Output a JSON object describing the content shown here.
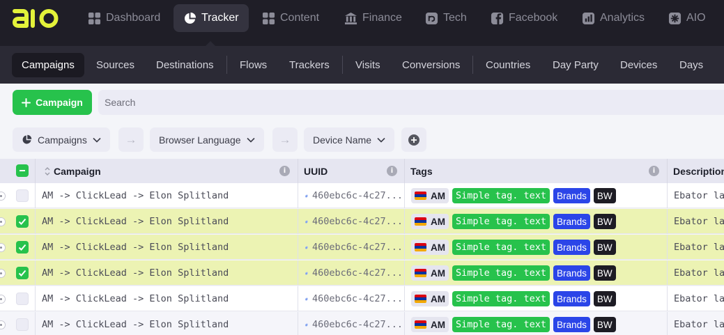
{
  "app": {
    "logo_text": "AIO"
  },
  "top_nav": [
    {
      "label": "Dashboard",
      "icon": "grid-icon"
    },
    {
      "label": "Tracker",
      "icon": "pie-chart-icon",
      "active": true
    },
    {
      "label": "Content",
      "icon": "grid-icon"
    },
    {
      "label": "Finance",
      "icon": "bank-icon"
    },
    {
      "label": "Tech",
      "icon": "tech-icon"
    },
    {
      "label": "Facebook",
      "icon": "facebook-icon"
    },
    {
      "label": "Analytics",
      "icon": "analytics-icon"
    },
    {
      "label": "AIO",
      "icon": "aio-icon"
    }
  ],
  "sub_nav": [
    {
      "label": "Campaigns",
      "active": true
    },
    {
      "label": "Sources"
    },
    {
      "label": "Destinations"
    },
    {
      "label": "Flows"
    },
    {
      "label": "Trackers"
    },
    {
      "label": "Visits"
    },
    {
      "label": "Conversions"
    },
    {
      "label": "Countries"
    },
    {
      "label": "Day Party"
    },
    {
      "label": "Devices"
    },
    {
      "label": "Days"
    }
  ],
  "actions": {
    "add_label": "Campaign",
    "search_placeholder": "Search"
  },
  "grouping": {
    "levels": [
      "Campaigns",
      "Browser Language",
      "Device Name"
    ],
    "arrow": "→"
  },
  "table": {
    "columns": [
      "Campaign",
      "UUID",
      "Tags",
      "Description"
    ],
    "info_glyph": "i",
    "rows": [
      {
        "selected": false,
        "campaign": "AM -> ClickLead -> Elon Splitland",
        "uuid": "460ebc6c-4c27...",
        "country": "AM",
        "tags": [
          "Simple tag. text",
          "Brands",
          "BW"
        ],
        "description": "Ebator lan"
      },
      {
        "selected": true,
        "campaign": "AM -> ClickLead -> Elon Splitland",
        "uuid": "460ebc6c-4c27...",
        "country": "AM",
        "tags": [
          "Simple tag. text",
          "Brands",
          "BW"
        ],
        "description": "Ebator lan"
      },
      {
        "selected": true,
        "campaign": "AM -> ClickLead -> Elon Splitland",
        "uuid": "460ebc6c-4c27...",
        "country": "AM",
        "tags": [
          "Simple tag. text",
          "Brands",
          "BW"
        ],
        "description": "Ebator lan"
      },
      {
        "selected": true,
        "campaign": "AM -> ClickLead -> Elon Splitland",
        "uuid": "460ebc6c-4c27...",
        "country": "AM",
        "tags": [
          "Simple tag. text",
          "Brands",
          "BW"
        ],
        "description": "Ebator lan"
      },
      {
        "selected": false,
        "campaign": "AM -> ClickLead -> Elon Splitland",
        "uuid": "460ebc6c-4c27...",
        "country": "AM",
        "tags": [
          "Simple tag. text",
          "Brands",
          "BW"
        ],
        "description": "Ebator lan"
      },
      {
        "selected": false,
        "campaign": "AM -> ClickLead -> Elon Splitland",
        "uuid": "460ebc6c-4c27...",
        "country": "AM",
        "tags": [
          "Simple tag. text",
          "Brands",
          "BW"
        ],
        "description": "Ebator lan"
      }
    ]
  },
  "colors": {
    "accent_green": "#27c24c",
    "tag_blue": "#2b45e8",
    "selected_row": "#ecf3b3",
    "logo_yellow": "#e3f23a"
  }
}
